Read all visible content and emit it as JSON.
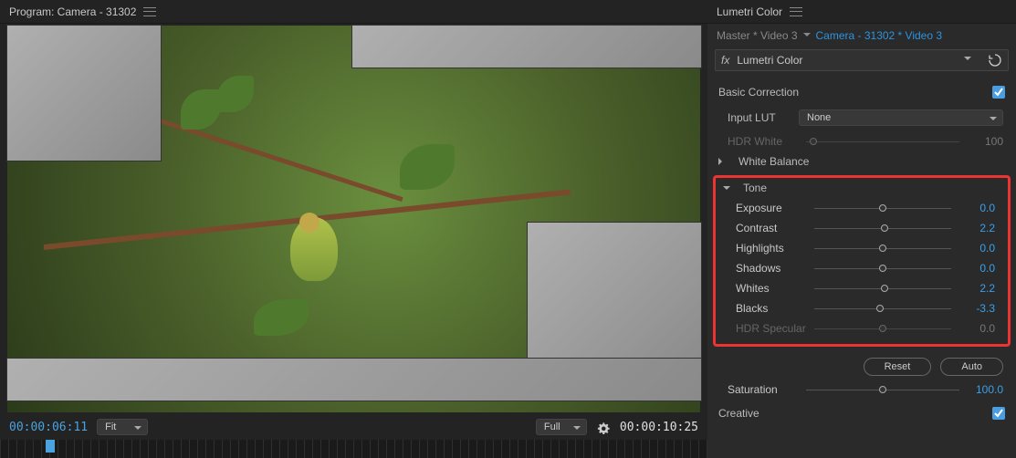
{
  "program_panel": {
    "title": "Program: Camera - 31302",
    "timecode_left": "00:00:06:11",
    "fit_label": "Fit",
    "zoom_label": "Full",
    "timecode_right": "00:00:10:25"
  },
  "lumetri": {
    "title": "Lumetri Color",
    "breadcrumb": {
      "master": "Master * Video 3",
      "clip": "Camera - 31302 * Video 3"
    },
    "effect_name": "Lumetri Color",
    "sections": {
      "basic_correction": "Basic Correction",
      "input_lut_label": "Input LUT",
      "input_lut_value": "None",
      "hdr_white_label": "HDR White",
      "hdr_white_value": "100",
      "white_balance": "White Balance",
      "tone": "Tone",
      "creative": "Creative"
    },
    "tone": {
      "exposure": {
        "label": "Exposure",
        "value": "0.0",
        "pos": 50
      },
      "contrast": {
        "label": "Contrast",
        "value": "2.2",
        "pos": 51
      },
      "highlights": {
        "label": "Highlights",
        "value": "0.0",
        "pos": 50
      },
      "shadows": {
        "label": "Shadows",
        "value": "0.0",
        "pos": 50
      },
      "whites": {
        "label": "Whites",
        "value": "2.2",
        "pos": 51
      },
      "blacks": {
        "label": "Blacks",
        "value": "-3.3",
        "pos": 48
      },
      "hdr_spec": {
        "label": "HDR Specular",
        "value": "0.0",
        "pos": 50
      }
    },
    "buttons": {
      "reset": "Reset",
      "auto": "Auto"
    },
    "saturation": {
      "label": "Saturation",
      "value": "100.0",
      "pos": 50
    }
  }
}
